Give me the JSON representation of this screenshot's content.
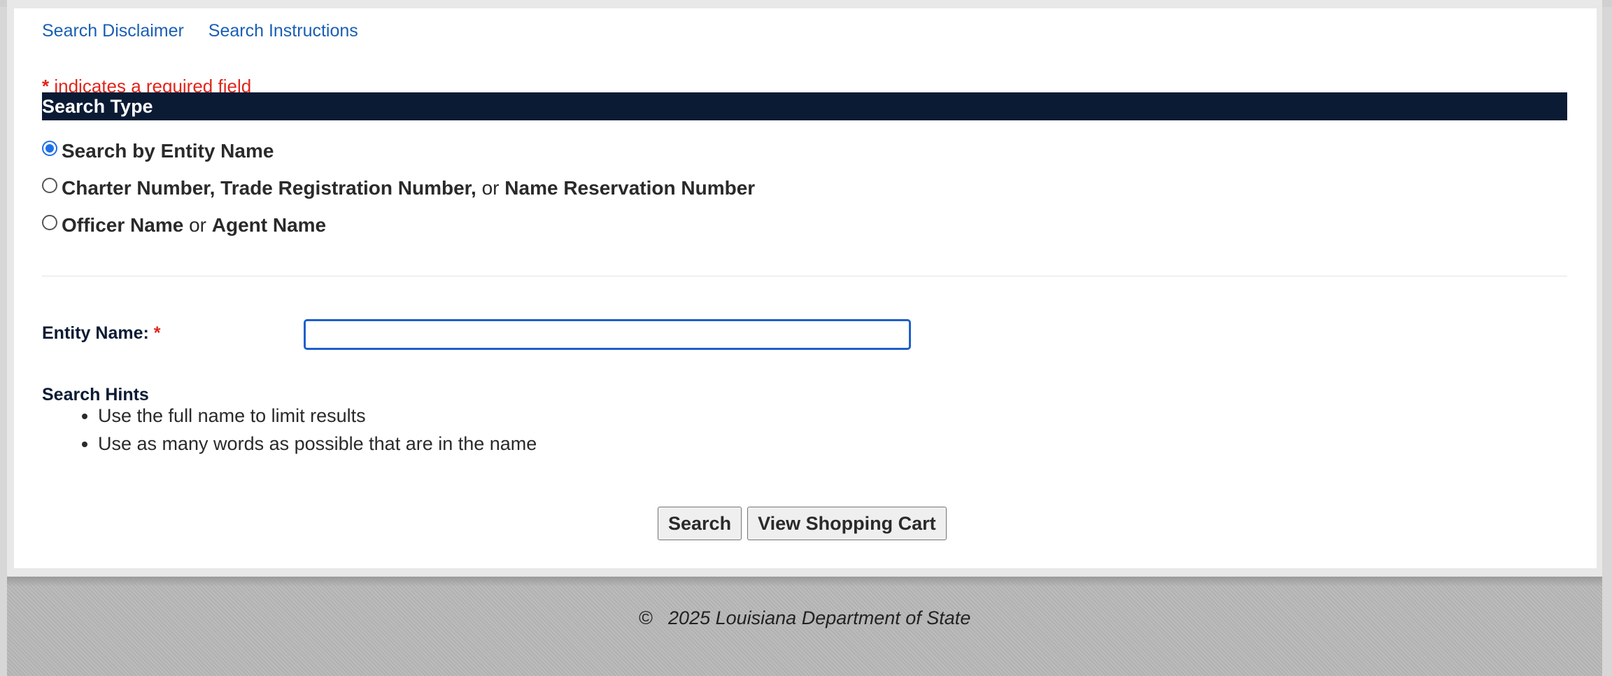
{
  "top_links": {
    "disclaimer": "Search Disclaimer",
    "instructions": "Search Instructions"
  },
  "required_note": {
    "star": "*",
    "text": " indicates a required field"
  },
  "search_type": {
    "header": "Search Type",
    "options": [
      {
        "parts": [
          "Search by Entity Name"
        ],
        "selected": true
      },
      {
        "parts": [
          "Charter Number, Trade Registration Number,",
          " or ",
          "Name Reservation Number"
        ],
        "selected": false
      },
      {
        "parts": [
          "Officer Name",
          " or ",
          "Agent Name"
        ],
        "selected": false
      }
    ]
  },
  "entity_field": {
    "label": "Entity Name:",
    "required_star": "*",
    "value": "",
    "placeholder": ""
  },
  "hints": {
    "title": "Search Hints",
    "items": [
      "Use the full name to limit results",
      "Use as many words as possible that are in the name"
    ]
  },
  "buttons": {
    "search": "Search",
    "view_cart": "View Shopping Cart"
  },
  "footer": {
    "text": "©   2025 Louisiana Department of State"
  },
  "colors": {
    "link": "#1a5fb4",
    "required": "#e0251b",
    "header_bar": "#0b1b34",
    "radio_selected": "#1f6fe5"
  }
}
